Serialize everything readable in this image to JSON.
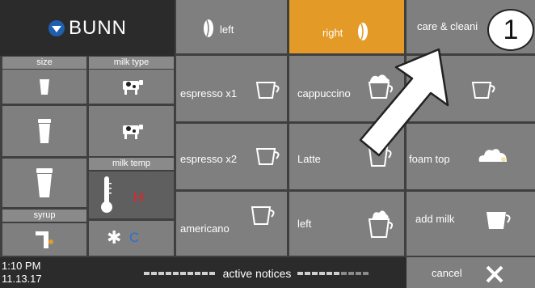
{
  "brand": {
    "logo_text": "BUNN"
  },
  "sidebar": {
    "size_header": "size",
    "milk_type_header": "milk type",
    "milk_temp_header": "milk temp",
    "syrup_header": "syrup",
    "milk_temp_hot_label": "H",
    "milk_temp_cold_label": "C"
  },
  "tabs": {
    "left_label": "left",
    "right_label": "right",
    "care_label": "care & cleani"
  },
  "drinks": {
    "espresso_x1": "espresso x1",
    "espresso_x2": "espresso x2",
    "americano": "americano",
    "cappuccino": "cappuccino",
    "latte": "Latte",
    "left": "left",
    "foam_top": "foam top",
    "add_milk": "add milk"
  },
  "footer": {
    "time": "1:10 PM",
    "date": "11.13.17",
    "notices_label": "active notices",
    "cancel_label": "cancel"
  },
  "annotation": {
    "callout_number": "1"
  },
  "icons": {
    "bean": "coffee-bean-icon",
    "cup": "cup-icon",
    "cow": "cow-icon",
    "thermometer": "thermometer-icon",
    "snowflake": "snowflake-icon",
    "syrup_pump": "syrup-pump-icon",
    "close": "close-icon"
  },
  "colors": {
    "accent_orange": "#e49a26",
    "tile_gray": "#7f7f7f",
    "dark_panel": "#2b2b2b",
    "hot_red": "#e0242b",
    "cold_blue": "#2b6fd6",
    "brand_blue": "#1f5fb0"
  }
}
